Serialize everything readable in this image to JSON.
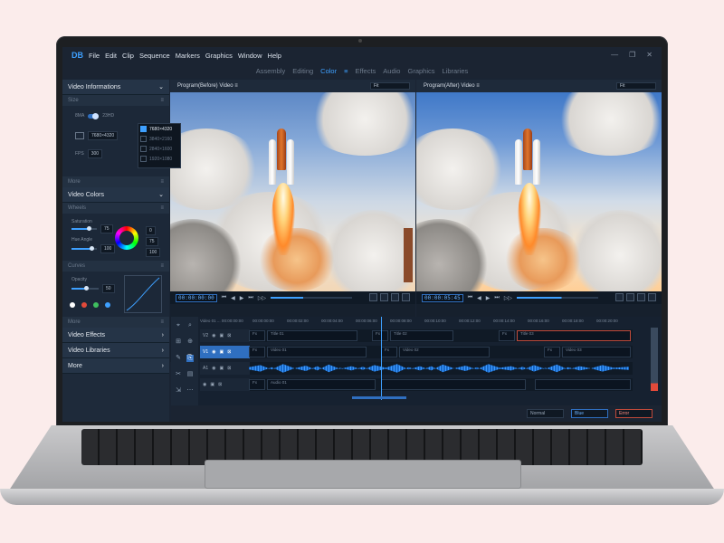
{
  "app": {
    "logo": "DB"
  },
  "menu": [
    "File",
    "Edit",
    "Clip",
    "Sequence",
    "Markers",
    "Graphics",
    "Window",
    "Help"
  ],
  "window_controls": [
    "—",
    "❐",
    "✕"
  ],
  "modes": [
    {
      "label": "Assembly",
      "active": false
    },
    {
      "label": "Editing",
      "active": false
    },
    {
      "label": "Color",
      "active": true
    },
    {
      "label": "≡",
      "active": true
    },
    {
      "label": "Effects",
      "active": false
    },
    {
      "label": "Audio",
      "active": false
    },
    {
      "label": "Graphics",
      "active": false
    },
    {
      "label": "Libraries",
      "active": false
    }
  ],
  "left_panel": {
    "video_info": {
      "title": "Video Informations",
      "chevron": "⌄"
    },
    "size": {
      "title": "Size",
      "menu": "≡",
      "toggle_left": "8MA",
      "toggle_right": "23HD",
      "resolution": "7680×4320",
      "fps_label": "FPS",
      "fps_value": "300",
      "options": [
        "7680×4320",
        "3840×2160",
        "2840×1600",
        "1920×1080"
      ],
      "selected_option": "7680×4320"
    },
    "more1": {
      "title": "More",
      "menu": "≡"
    },
    "video_colors": {
      "title": "Video Colors",
      "chevron": "⌄"
    },
    "wheels": {
      "title": "Wheels",
      "menu": "≡",
      "sat_label": "Saturation",
      "sat_value": "75",
      "hue_label": "Hue Angle",
      "hue_value": "100",
      "side_values": [
        "0",
        "75",
        "100"
      ],
      "saturation": 0.7,
      "hue": 0.8
    },
    "curves": {
      "title": "Curves",
      "menu": "≡",
      "opacity_label": "Opacity",
      "opacity_value": "50",
      "opacity": 0.55,
      "dot_colors": [
        "#ffffff",
        "#e24a3a",
        "#3fbf5f",
        "#3ea0ff"
      ]
    },
    "more2": {
      "title": "More",
      "menu": "≡"
    },
    "video_effects": {
      "title": "Video Effects",
      "chevron": "›"
    },
    "video_libraries": {
      "title": "Video Libraries",
      "chevron": "›"
    },
    "more3": {
      "title": "More",
      "chevron": "›"
    }
  },
  "viewers": [
    {
      "title": "Program(Before) Video",
      "menu": "≡",
      "fit": "Fit",
      "timecode": "00:00:00:00",
      "progress": 0.4
    },
    {
      "title": "Program(After) Video",
      "menu": "≡",
      "fit": "Fit",
      "timecode": "00:00:05:45",
      "progress": 0.55
    }
  ],
  "transport_controls": [
    "⏮",
    "◀",
    "▶",
    "⏭",
    "▷▷"
  ],
  "timeline": {
    "sequence_label": "Video 01 ... 00:00:00:00",
    "ruler": [
      "00:00:00:00",
      "00:00:02:00",
      "00:00:04:00",
      "00:00:06:00",
      "00:00:08:00",
      "00:00:10:00",
      "00:00:12:00",
      "00:00:14:00",
      "00:00:16:00",
      "00:00:18:00",
      "00:00:20:00"
    ],
    "tracks": [
      {
        "label": "V2",
        "clips": [
          "Fx",
          "Title 01",
          "Fx",
          "Title 02",
          "Fx",
          "Title 03"
        ]
      },
      {
        "label": "V1",
        "clips": [
          "Fx",
          "Video 01",
          "Fx",
          "Video 02",
          "Fx",
          "Video 03"
        ]
      },
      {
        "label": "A1",
        "clips": [
          "Fx",
          "Audio 01"
        ]
      }
    ],
    "tools": [
      "⌖",
      "⌕",
      "⊞",
      "⊕",
      "✎",
      "⎘",
      "✂",
      "▤",
      "⇲",
      "⋯"
    ]
  },
  "bottom_buttons": [
    {
      "label": "Normal",
      "style": "plain"
    },
    {
      "label": "Blue",
      "style": "blue"
    },
    {
      "label": "Error",
      "style": "red"
    }
  ],
  "colors": {
    "accent": "#3ea0ff",
    "panel": "#1e2a3a",
    "background": "#fbeceb"
  }
}
